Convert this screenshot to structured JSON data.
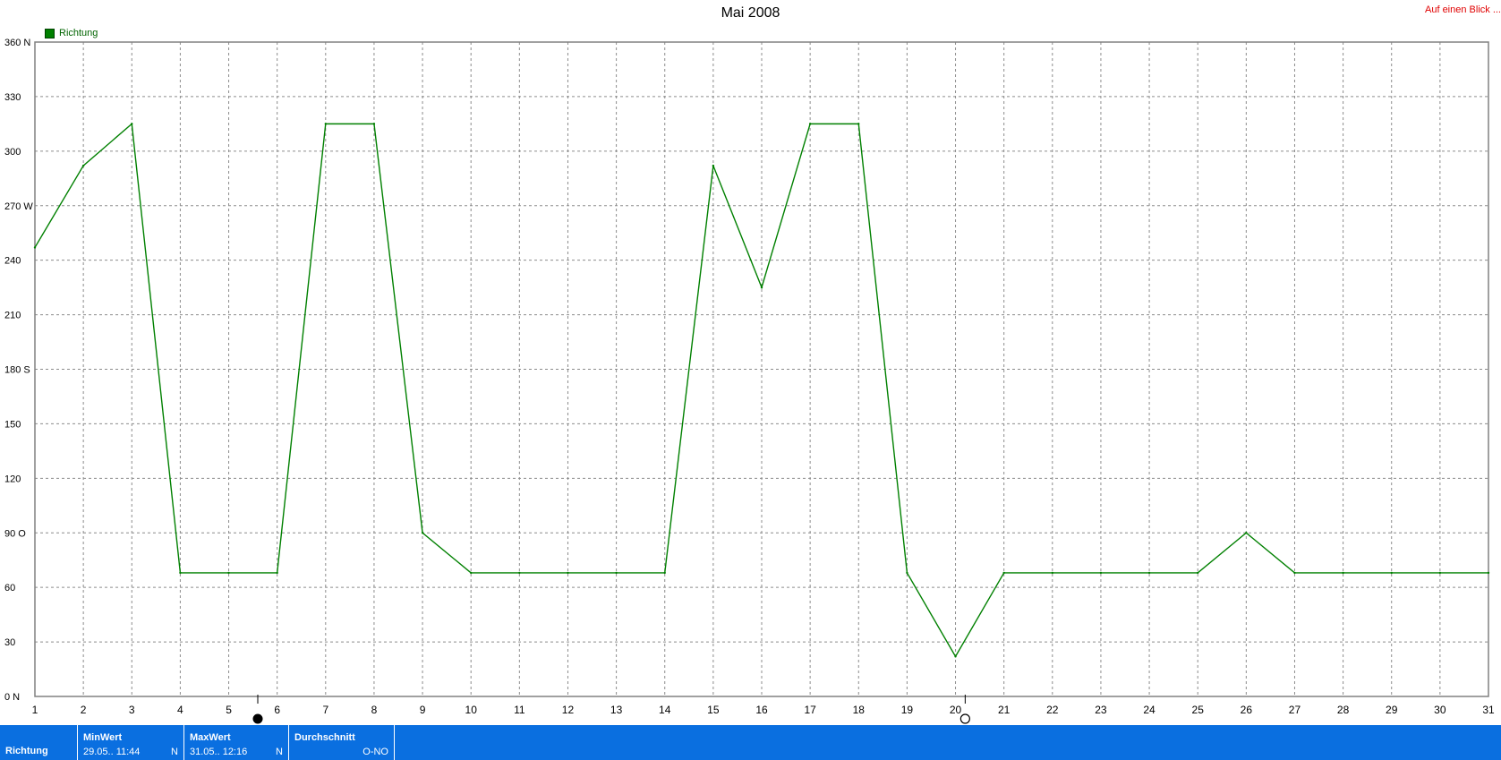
{
  "header": {
    "title": "Mai 2008",
    "link_label": "Auf einen Blick ..."
  },
  "colors": {
    "series": "#008000",
    "grid": "#8c8c8c",
    "bar": "#0a6fe0",
    "link": "#e00000"
  },
  "chart_data": {
    "type": "line",
    "title": "Mai 2008",
    "x_ticks": [
      "1",
      "2",
      "3",
      "4",
      "5",
      "6",
      "7",
      "8",
      "9",
      "10",
      "11",
      "12",
      "13",
      "14",
      "15",
      "16",
      "17",
      "18",
      "19",
      "20",
      "21",
      "22",
      "23",
      "24",
      "25",
      "26",
      "27",
      "28",
      "29",
      "30",
      "31"
    ],
    "y_ticks": [
      "0 N",
      "30",
      "60",
      "90 O",
      "120",
      "150",
      "180 S",
      "210",
      "240",
      "270 W",
      "300",
      "330",
      "360 N"
    ],
    "xlim": [
      1,
      31
    ],
    "ylim": [
      0,
      360
    ],
    "grid": true,
    "legend_position": "top-left",
    "series": [
      {
        "name": "Richtung",
        "x": [
          1,
          2,
          3,
          4,
          5,
          6,
          7,
          8,
          9,
          10,
          11,
          12,
          13,
          14,
          15,
          16,
          17,
          18,
          19,
          20,
          21,
          22,
          23,
          24,
          25,
          26,
          27,
          28,
          29,
          30,
          31
        ],
        "values": [
          247,
          292,
          315,
          68,
          68,
          68,
          315,
          315,
          90,
          68,
          68,
          68,
          68,
          68,
          292,
          225,
          315,
          315,
          68,
          22,
          68,
          68,
          68,
          68,
          68,
          90,
          68,
          68,
          68,
          68,
          68
        ]
      }
    ],
    "moon_phases": [
      {
        "day": 5.6,
        "icon": "new-moon-icon"
      },
      {
        "day": 20.2,
        "icon": "full-moon-icon"
      }
    ]
  },
  "summary": {
    "row_label": "Richtung",
    "min": {
      "label": "MinWert",
      "time": "29.05.. 11:44",
      "value": "N"
    },
    "max": {
      "label": "MaxWert",
      "time": "31.05.. 12:16",
      "value": "N"
    },
    "avg": {
      "label": "Durchschnitt",
      "value": "O-NO"
    }
  }
}
